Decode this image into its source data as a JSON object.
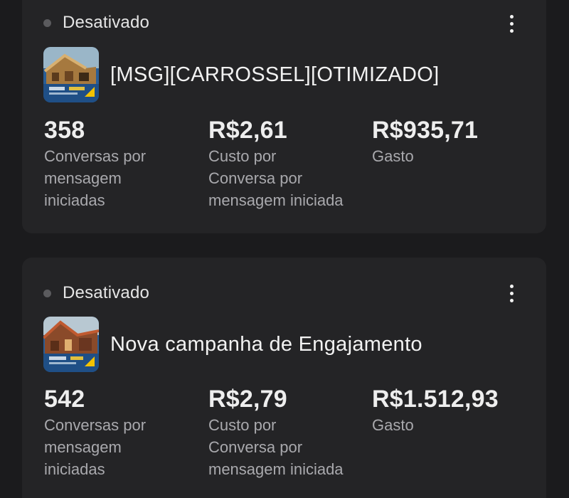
{
  "campaigns": [
    {
      "status": "Desativado",
      "title": "[MSG][CARROSSEL][OTIMIZADO]",
      "metrics": [
        {
          "value": "358",
          "label_lines": [
            "Conversas por",
            "mensagem",
            "iniciadas"
          ]
        },
        {
          "value": "R$2,61",
          "label_lines": [
            "Custo por",
            "Conversa por",
            "mensagem iniciada"
          ]
        },
        {
          "value": "R$935,71",
          "label_lines": [
            "Gasto"
          ]
        }
      ]
    },
    {
      "status": "Desativado",
      "title": "Nova campanha de Engajamento",
      "metrics": [
        {
          "value": "542",
          "label_lines": [
            "Conversas por",
            "mensagem",
            "iniciadas"
          ]
        },
        {
          "value": "R$2,79",
          "label_lines": [
            "Custo por",
            "Conversa por",
            "mensagem iniciada"
          ]
        },
        {
          "value": "R$1.512,93",
          "label_lines": [
            "Gasto"
          ]
        }
      ]
    }
  ],
  "icons": {
    "status": "status-dot-icon",
    "menu": "more-vertical-icon"
  },
  "colors": {
    "background": "#1b1b1d",
    "card": "#242426",
    "status_dot": "#5b5b5e",
    "label_text": "#a9a9ad",
    "value_text": "#eeeeee"
  }
}
